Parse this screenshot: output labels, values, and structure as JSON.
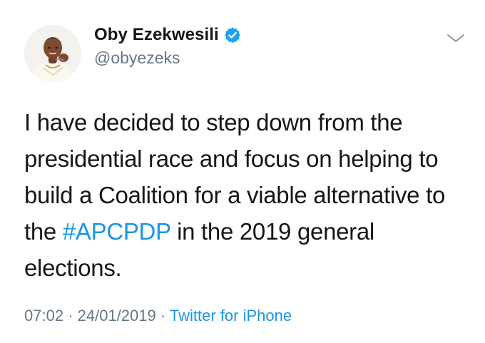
{
  "author": {
    "display_name": "Oby Ezekwesili",
    "handle": "@obyezeks",
    "verified": true
  },
  "tweet": {
    "text_before": "I have decided to step down from the presidential race and focus on helping to build a Coalition for a viable alternative to the ",
    "hashtag": "#APCPDP",
    "text_after": " in the 2019 general elections."
  },
  "meta": {
    "time": "07:02",
    "separator": "·",
    "date": "24/01/2019",
    "source": "Twitter for iPhone"
  },
  "icons": {
    "verified": "verified-badge-icon",
    "chevron": "chevron-down-icon"
  },
  "colors": {
    "link": "#1b95e0",
    "secondary_text": "#657786",
    "verified_badge": "#1da1f2"
  }
}
